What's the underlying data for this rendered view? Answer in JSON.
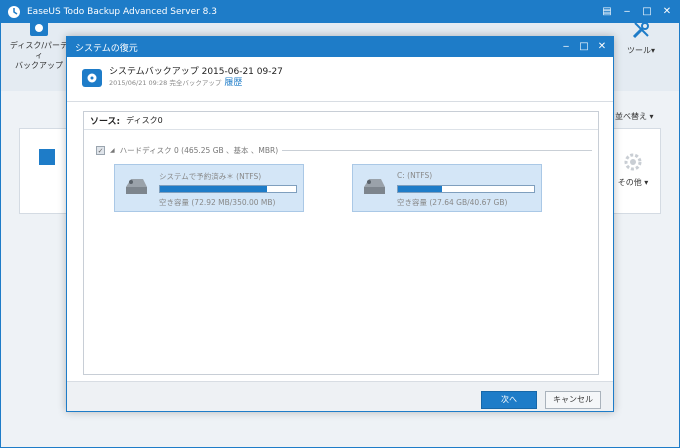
{
  "app": {
    "title": "EaseUS Todo Backup Advanced Server 8.3",
    "toolbar_left_label": "ディスク/パーティ\nバックアップ",
    "tools_label": "ツール",
    "sort_label": "並べ替え",
    "other_label": "その他"
  },
  "dialog": {
    "title": "システムの復元",
    "backup_name": "システムバックアップ 2015-06-21 09-27",
    "backup_sub": "2015/06/21 09:28 完全バックアップ",
    "history_link": "履歴",
    "source_label": "ソース:",
    "source_value": "ディスク0",
    "disk_label": "ハードディスク 0 (465.25 GB 、基本 、MBR)",
    "partitions": [
      {
        "name": "システムで予約済み＊ (NTFS)",
        "free": "空き容量 (72.92 MB/350.00 MB)",
        "used_fraction": 0.79
      },
      {
        "name": "C: (NTFS)",
        "free": "空き容量 (27.64 GB/40.67 GB)",
        "used_fraction": 0.32
      }
    ],
    "next_button": "次へ",
    "cancel_button": "キャンセル"
  },
  "colors": {
    "accent": "#1e7cc8",
    "partition_bg": "#d4e6f7"
  }
}
